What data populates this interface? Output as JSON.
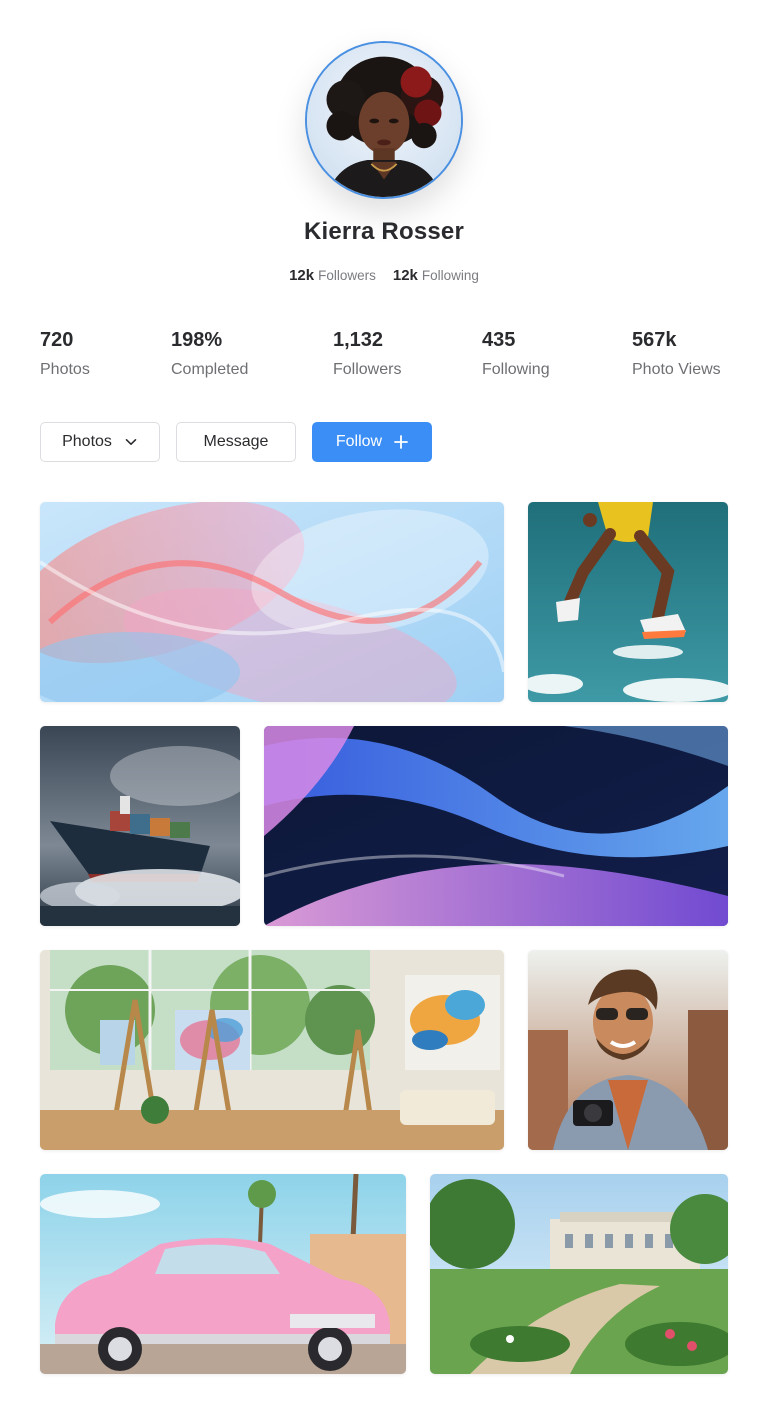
{
  "profile": {
    "name": "Kierra Rosser",
    "followers_count": "12k",
    "followers_label": "Followers",
    "following_count": "12k",
    "following_label": "Following"
  },
  "stats": [
    {
      "value": "720",
      "label": "Photos"
    },
    {
      "value": "198%",
      "label": "Completed"
    },
    {
      "value": "1,132",
      "label": "Followers"
    },
    {
      "value": "435",
      "label": "Following"
    },
    {
      "value": "567k",
      "label": "Photo Views"
    }
  ],
  "actions": {
    "photos_label": "Photos",
    "message_label": "Message",
    "follow_label": "Follow"
  },
  "icons": {
    "dropdown": "chevron-down-icon",
    "follow": "plus-icon"
  },
  "colors": {
    "accent": "#3a8ef5",
    "avatar_ring": "#4a90e2"
  },
  "gallery": [
    {
      "subject": "pink-glass-waves-abstract"
    },
    {
      "subject": "jumping-athlete"
    },
    {
      "subject": "container-ship"
    },
    {
      "subject": "blue-purple-waves-abstract"
    },
    {
      "subject": "art-studio"
    },
    {
      "subject": "smiling-man-with-camera"
    },
    {
      "subject": "pink-vintage-car"
    },
    {
      "subject": "garden-mansion"
    }
  ]
}
